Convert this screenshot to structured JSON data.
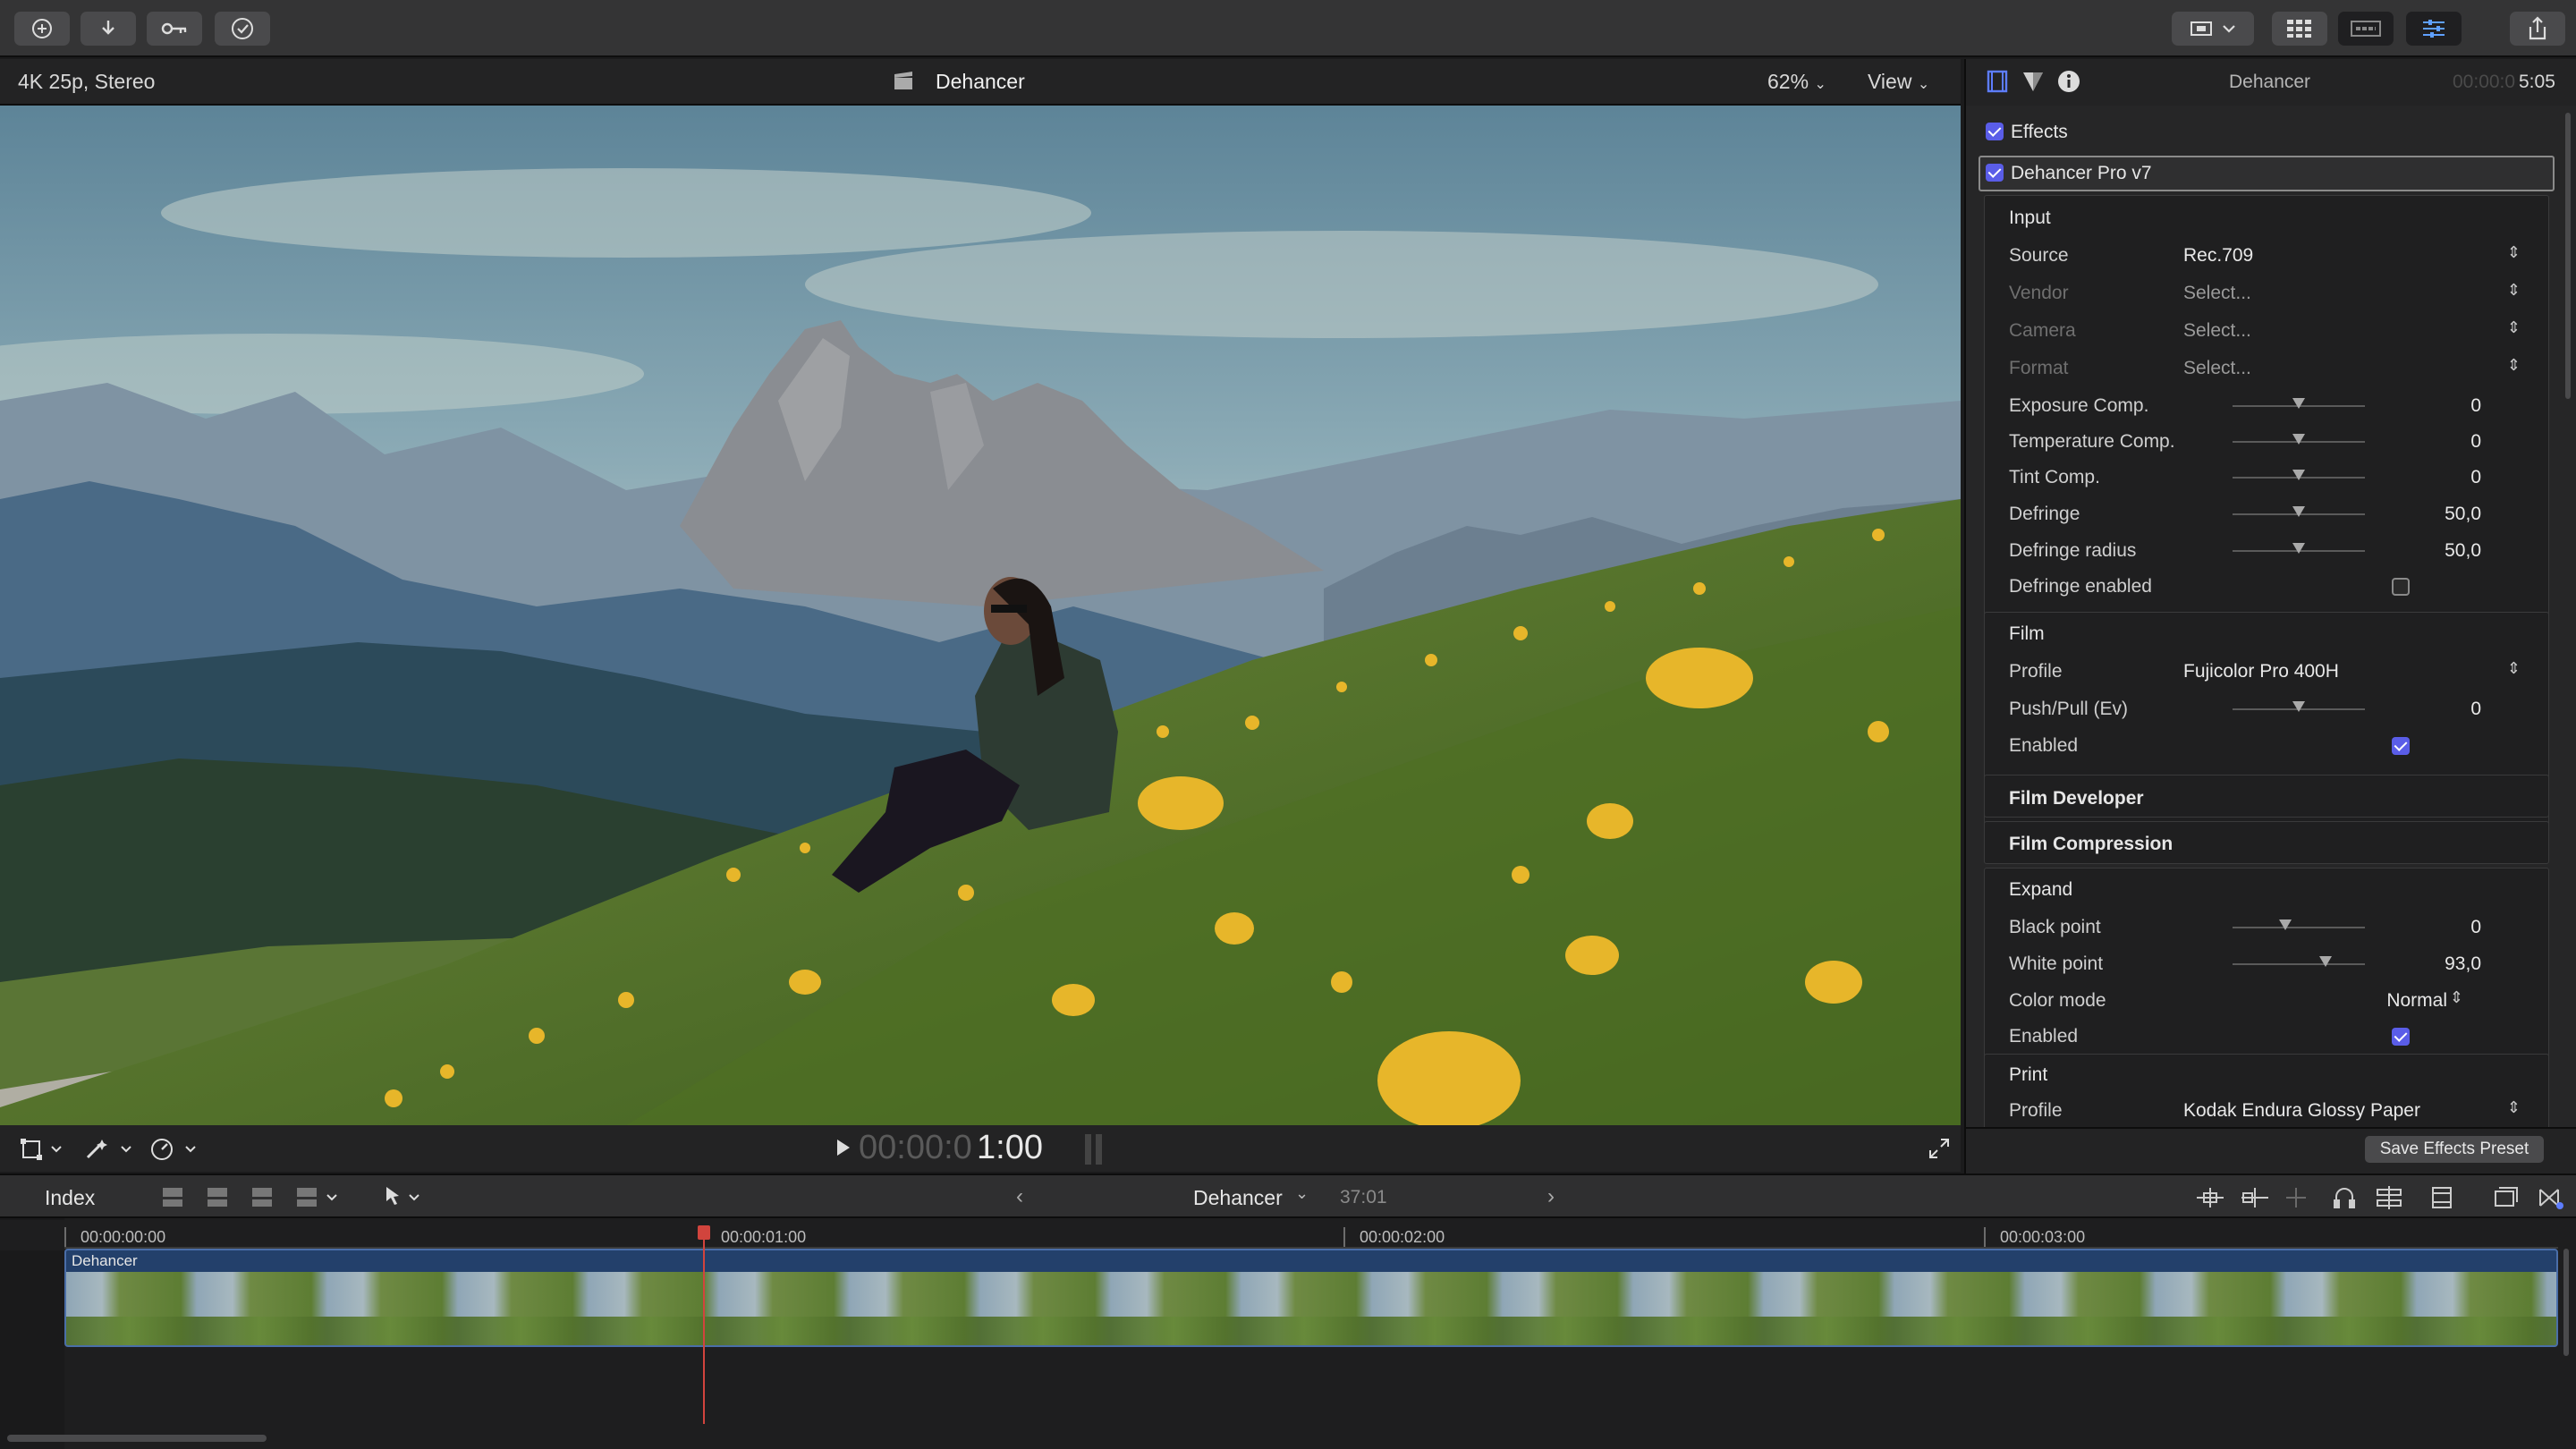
{
  "toolbar": {
    "left_icons": [
      "add-icon",
      "import-icon",
      "keyword-icon",
      "check-icon"
    ],
    "right_icons": [
      "display-icon",
      "chevron-down-icon",
      "browser-icon",
      "timeline-index-icon",
      "inspector-icon",
      "share-icon"
    ]
  },
  "viewer": {
    "format": "4K 25p, Stereo",
    "project_title": "Dehancer",
    "zoom": "62%",
    "view_label": "View",
    "timecode_dim": "00:00:0",
    "timecode_bright": "1:00"
  },
  "inspector": {
    "title": "Dehancer",
    "duration_dim": "00:00:0",
    "duration_bright": "5:05",
    "effects_label": "Effects",
    "effect_name": "Dehancer Pro v7",
    "sections": {
      "input": "Input",
      "film": "Film",
      "film_developer": "Film Developer",
      "film_compression": "Film Compression",
      "expand": "Expand",
      "print": "Print"
    },
    "input": {
      "source_label": "Source",
      "source_value": "Rec.709",
      "vendor_label": "Vendor",
      "vendor_value": "Select...",
      "camera_label": "Camera",
      "camera_value": "Select...",
      "format_label": "Format",
      "format_value": "Select...",
      "exposure_label": "Exposure Comp.",
      "exposure_value": "0",
      "exposure_level": 0.5,
      "temperature_label": "Temperature Comp.",
      "temperature_value": "0",
      "temperature_level": 0.5,
      "tint_label": "Tint Comp.",
      "tint_value": "0",
      "tint_level": 0.5,
      "defringe_label": "Defringe",
      "defringe_value": "50,0",
      "defringe_level": 0.5,
      "defringe_radius_label": "Defringe radius",
      "defringe_radius_value": "50,0",
      "defringe_radius_level": 0.5,
      "defringe_enabled_label": "Defringe enabled"
    },
    "film": {
      "profile_label": "Profile",
      "profile_value": "Fujicolor Pro 400H",
      "pushpull_label": "Push/Pull (Ev)",
      "pushpull_value": "0",
      "pushpull_level": 0.5,
      "enabled_label": "Enabled"
    },
    "expand": {
      "black_label": "Black point",
      "black_value": "0",
      "black_level": 0.4,
      "white_label": "White point",
      "white_value": "93,0",
      "white_level": 0.7,
      "color_mode_label": "Color mode",
      "color_mode_value": "Normal",
      "enabled_label": "Enabled"
    },
    "print": {
      "profile_label": "Profile",
      "profile_value": "Kodak Endura Glossy Paper"
    },
    "save_preset": "Save Effects Preset"
  },
  "timeline": {
    "index_label": "Index",
    "project_name": "Dehancer",
    "project_duration": "37:01",
    "clip_name": "Dehancer",
    "ruler": [
      "00:00:00:00",
      "00:00:01:00",
      "00:00:02:00",
      "00:00:03:00"
    ]
  }
}
